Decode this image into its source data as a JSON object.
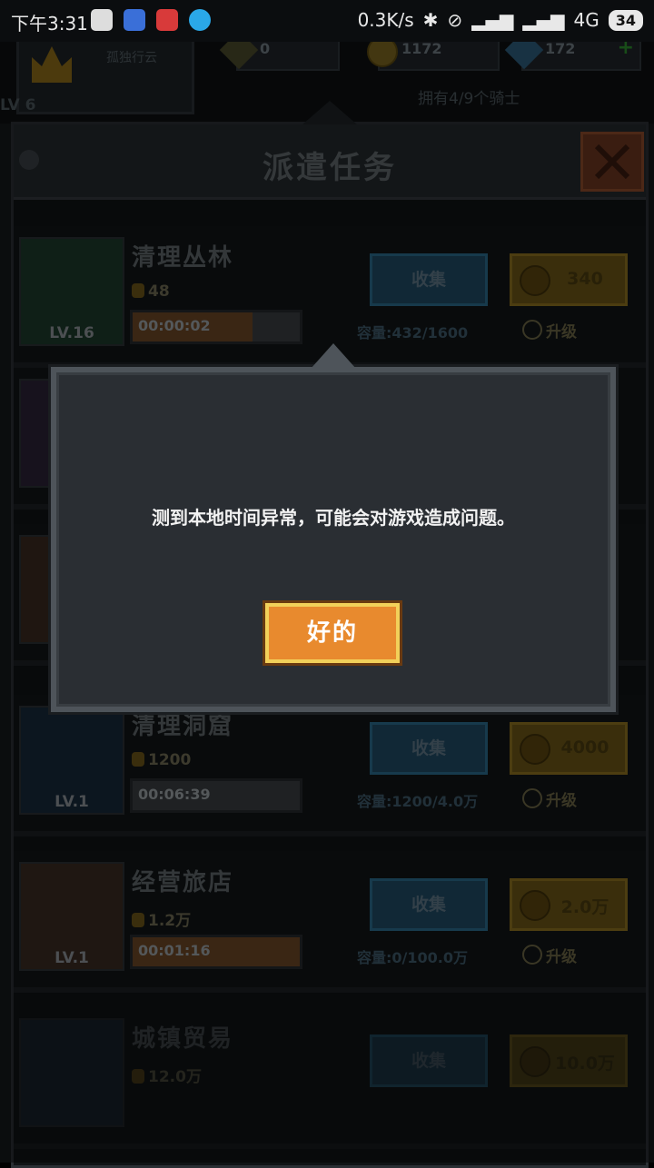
{
  "status_bar": {
    "time": "下午3:31",
    "net_speed": "0.3K/s",
    "network": "4G",
    "battery": "34"
  },
  "hud": {
    "sub_label": "孤独行云",
    "coins": "1172",
    "gems": "172",
    "attack": "0",
    "knights": "拥有4/9个骑士",
    "level": "LV 6"
  },
  "panel": {
    "title": "派遣任务"
  },
  "tasks": [
    {
      "name": "清理丛林",
      "level": "LV.16",
      "reward": "48",
      "timer": "00:00:02",
      "progress": 0.72,
      "collect": "收集",
      "upgrade_cost": "340",
      "capacity": "容量:432/1600",
      "upgrade_label": "升级"
    },
    {
      "name": "清理洞窟",
      "level": "LV.1",
      "reward": "1200",
      "timer": "00:06:39",
      "progress": 0.0,
      "collect": "收集",
      "upgrade_cost": "4000",
      "capacity": "容量:1200/4.0万",
      "upgrade_label": "升级"
    },
    {
      "name": "经营旅店",
      "level": "LV.1",
      "reward": "1.2万",
      "timer": "00:01:16",
      "progress": 1.0,
      "collect": "收集",
      "upgrade_cost": "2.0万",
      "capacity": "容量:0/100.0万",
      "upgrade_label": "升级"
    },
    {
      "name": "城镇贸易",
      "level": "",
      "reward": "12.0万",
      "timer": "",
      "progress": 0.0,
      "collect": "收集",
      "upgrade_cost": "10.0万",
      "capacity": "",
      "upgrade_label": ""
    }
  ],
  "dialog": {
    "message": "测到本地时间异常，可能会对游戏造成问题。",
    "ok": "好的"
  },
  "colors": {
    "dialog_bg": "#2a2e33",
    "ok_button": "#e88a2e",
    "collect_button": "#1f4a63",
    "upgrade_button": "#6a5516"
  }
}
